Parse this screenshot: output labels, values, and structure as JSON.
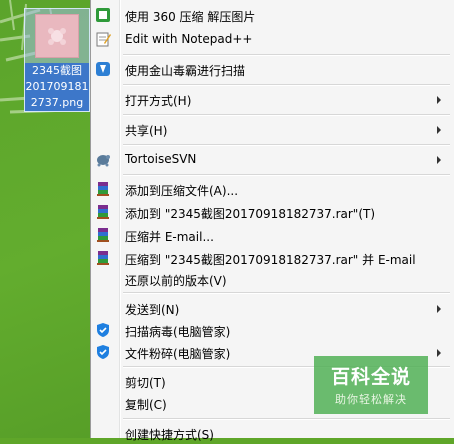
{
  "desktop": {
    "file_label_lines": [
      "2345截图",
      "201709181",
      "2737.png"
    ]
  },
  "menu": {
    "items": [
      {
        "label": "使用 360 压缩 解压图片",
        "icon": "green-app-icon",
        "submenu": false
      },
      {
        "label": "Edit with Notepad++",
        "icon": "notepad-icon",
        "submenu": false
      },
      {
        "label": "使用金山毒霸进行扫描",
        "icon": "kingsoft-antivirus-icon",
        "submenu": false
      },
      {
        "label": "打开方式(H)",
        "icon": "",
        "submenu": true
      },
      {
        "label": "共享(H)",
        "icon": "",
        "submenu": true
      },
      {
        "label": "TortoiseSVN",
        "icon": "tortoise-icon",
        "submenu": true
      },
      {
        "label": "添加到压缩文件(A)...",
        "icon": "winrar-icon",
        "submenu": false
      },
      {
        "label": "添加到 \"2345截图20170918182737.rar\"(T)",
        "icon": "winrar-icon",
        "submenu": false
      },
      {
        "label": "压缩并 E-mail...",
        "icon": "winrar-icon",
        "submenu": false
      },
      {
        "label": "压缩到 \"2345截图20170918182737.rar\" 并 E-mail",
        "icon": "winrar-icon",
        "submenu": false
      },
      {
        "label": "还原以前的版本(V)",
        "icon": "",
        "submenu": false
      },
      {
        "label": "发送到(N)",
        "icon": "",
        "submenu": true
      },
      {
        "label": "扫描病毒(电脑管家)",
        "icon": "tencent-shield-icon",
        "submenu": false
      },
      {
        "label": "文件粉碎(电脑管家)",
        "icon": "tencent-shield-icon",
        "submenu": true
      },
      {
        "label": "剪切(T)",
        "icon": "",
        "submenu": false
      },
      {
        "label": "复制(C)",
        "icon": "",
        "submenu": false
      },
      {
        "label": "创建快捷方式(S)",
        "icon": "",
        "submenu": false
      }
    ]
  },
  "watermark": {
    "title": "百科全说",
    "subtitle": "助你轻松解决"
  },
  "colors": {
    "desktop_green": "#5fa629",
    "menu_bg": "#f5f5f5",
    "selection_blue": "#3d77c9",
    "watermark_green": "#4caf50"
  }
}
